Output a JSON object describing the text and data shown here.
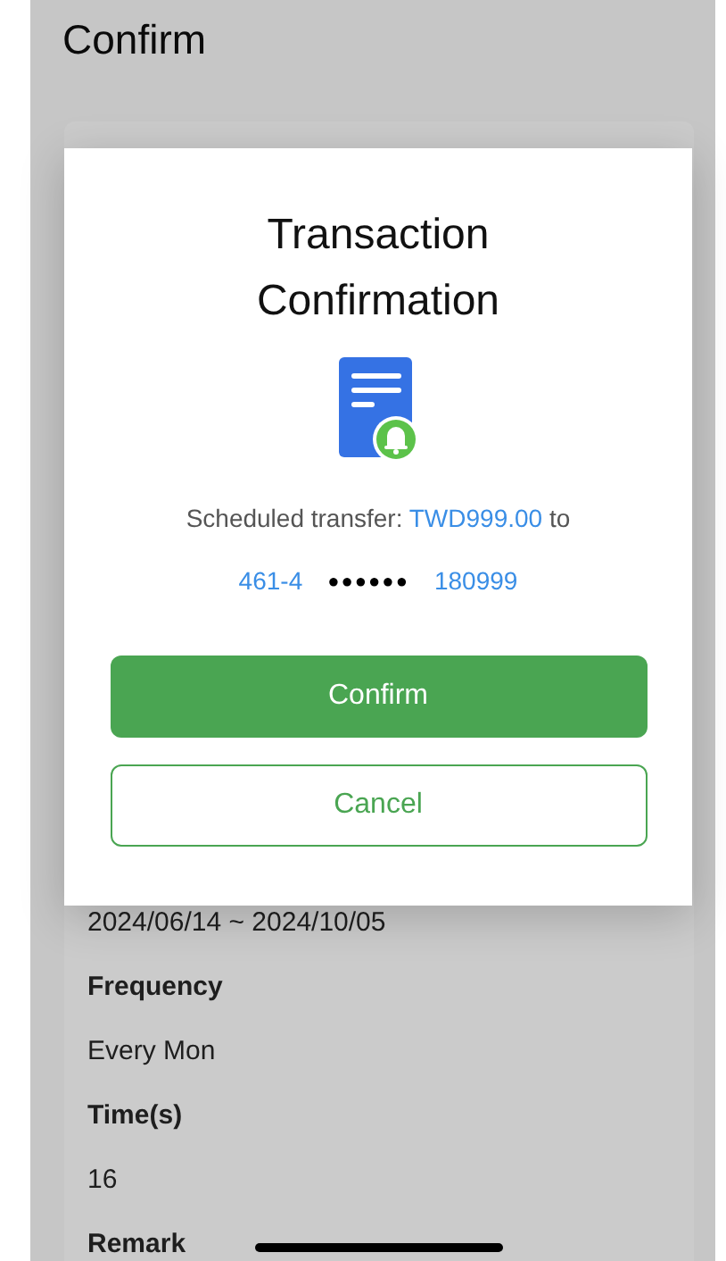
{
  "page": {
    "title": "Confirm",
    "details": [
      {
        "kind": "value",
        "text": "2024/06/14 ~ 2024/10/05"
      },
      {
        "kind": "label",
        "text": "Frequency"
      },
      {
        "kind": "value",
        "text": "Every Mon"
      },
      {
        "kind": "label",
        "text": "Time(s)"
      },
      {
        "kind": "value",
        "text": "16"
      },
      {
        "kind": "label",
        "text": "Remark"
      }
    ]
  },
  "dialog": {
    "title": "Transaction Confirmation",
    "message": "Scheduled transfer:",
    "amount": "TWD999.00",
    "message_end": "to",
    "account_parts": [
      "461-4",
      "●●●●●●",
      "180999"
    ],
    "buttons": [
      {
        "kind": "primary",
        "label": "Confirm"
      },
      {
        "kind": "secondary",
        "label": "Cancel"
      }
    ]
  }
}
